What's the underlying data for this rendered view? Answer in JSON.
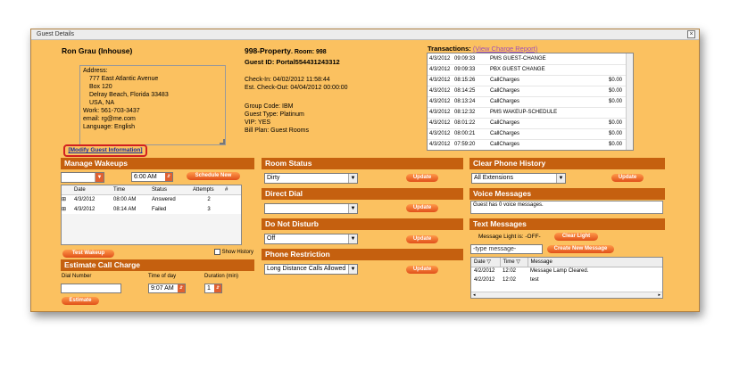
{
  "window": {
    "title": "Guest Details",
    "close": "×"
  },
  "guest": {
    "name": "Ron Grau",
    "status": "(Inhouse)",
    "address_label": "Address:",
    "address_lines": [
      "777 East Atlantic Avenue",
      "Box 120",
      "Delray Beach, Florida 33483",
      "USA, NA"
    ],
    "work": "Work:  561-703-3437",
    "email": "email: rg@me.com",
    "language": "Language: English",
    "modify_link": "[Modify Guest Information]"
  },
  "property": {
    "title": "998-Property",
    "room": ". Room: 998",
    "guest_id": "Guest ID: Portal554431243312",
    "check_in": "Check-In: 04/02/2012 11:58:44",
    "check_out": "Est. Check-Out: 04/04/2012 00:00:00",
    "group_code": "Group Code: IBM",
    "guest_type": "Guest Type: Platinum",
    "vip": "VIP: YES",
    "bill_plan": "Bill Plan: Guest Rooms"
  },
  "transactions": {
    "label": "Transactions:",
    "link": "(View Charge Report)",
    "rows": [
      {
        "date": "4/3/2012",
        "time": "09:09:33",
        "desc": "PMS GUEST-CHANGE",
        "amt": ""
      },
      {
        "date": "4/3/2012",
        "time": "09:09:33",
        "desc": "PBX GUEST CHANGE",
        "amt": ""
      },
      {
        "date": "4/3/2012",
        "time": "08:15:26",
        "desc": "CallCharges",
        "amt": "$0.00"
      },
      {
        "date": "4/3/2012",
        "time": "08:14:25",
        "desc": "CallCharges",
        "amt": "$0.00"
      },
      {
        "date": "4/3/2012",
        "time": "08:13:24",
        "desc": "CallCharges",
        "amt": "$0.00"
      },
      {
        "date": "4/3/2012",
        "time": "08:12:32",
        "desc": "PMS WAKEUP-SCHEDULE",
        "amt": ""
      },
      {
        "date": "4/3/2012",
        "time": "08:01:22",
        "desc": "CallCharges",
        "amt": "$0.00"
      },
      {
        "date": "4/3/2012",
        "time": "08:00:21",
        "desc": "CallCharges",
        "amt": "$0.00"
      },
      {
        "date": "4/3/2012",
        "time": "07:59:20",
        "desc": "CallCharges",
        "amt": "$0.00"
      }
    ]
  },
  "wakeups": {
    "header": "Manage Wakeups",
    "time_value": "6:00 AM",
    "schedule_btn": "Schedule New",
    "columns": [
      "Date",
      "Time",
      "Status",
      "Attempts",
      "#"
    ],
    "rows": [
      {
        "expand": "⊞",
        "date": "4/3/2012",
        "time": "08:00 AM",
        "status": "Answered",
        "attempts": "2"
      },
      {
        "expand": "⊞",
        "date": "4/3/2012",
        "time": "08:14 AM",
        "status": "Failed",
        "attempts": "3"
      }
    ],
    "test_btn": "Test Wakeup",
    "show_history": "Show History"
  },
  "estimate": {
    "header": "Estimate Call Charge",
    "dial_label": "Dial Number",
    "time_label": "Time of day",
    "duration_label": "Duration (min)",
    "time_value": "9:07 AM",
    "duration_value": "1",
    "btn": "Estimate"
  },
  "room_status": {
    "header": "Room Status",
    "value": "Dirty",
    "btn": "Update"
  },
  "direct_dial": {
    "header": "Direct Dial",
    "value": "",
    "btn": "Update"
  },
  "dnd": {
    "header": "Do Not Disturb",
    "value": "Off",
    "btn": "Update"
  },
  "phone_restriction": {
    "header": "Phone Restriction",
    "value": "Long Distance Calls Allowed",
    "btn": "Update"
  },
  "clear_phone": {
    "header": "Clear Phone History",
    "value": "All Extensions",
    "btn": "Update"
  },
  "voice": {
    "header": "Voice Messages",
    "text": "Guest has 0 voice messages."
  },
  "text_messages": {
    "header": "Text Messages",
    "light": "Message Light is: -OFF-",
    "clear_light_btn": "Clear Light",
    "type_placeholder": "-type message-",
    "create_btn": "Create New Message",
    "columns": [
      "Date",
      "Time",
      "Message"
    ],
    "rows": [
      {
        "date": "4/2/2012",
        "time": "12:02",
        "msg": "Message Lamp Cleared."
      },
      {
        "date": "4/2/2012",
        "time": "12:02",
        "msg": "test"
      }
    ]
  },
  "colors": {
    "header": "#c5600f",
    "background": "#fbc160",
    "button": "#e0501a",
    "highlight": "#d22020"
  }
}
